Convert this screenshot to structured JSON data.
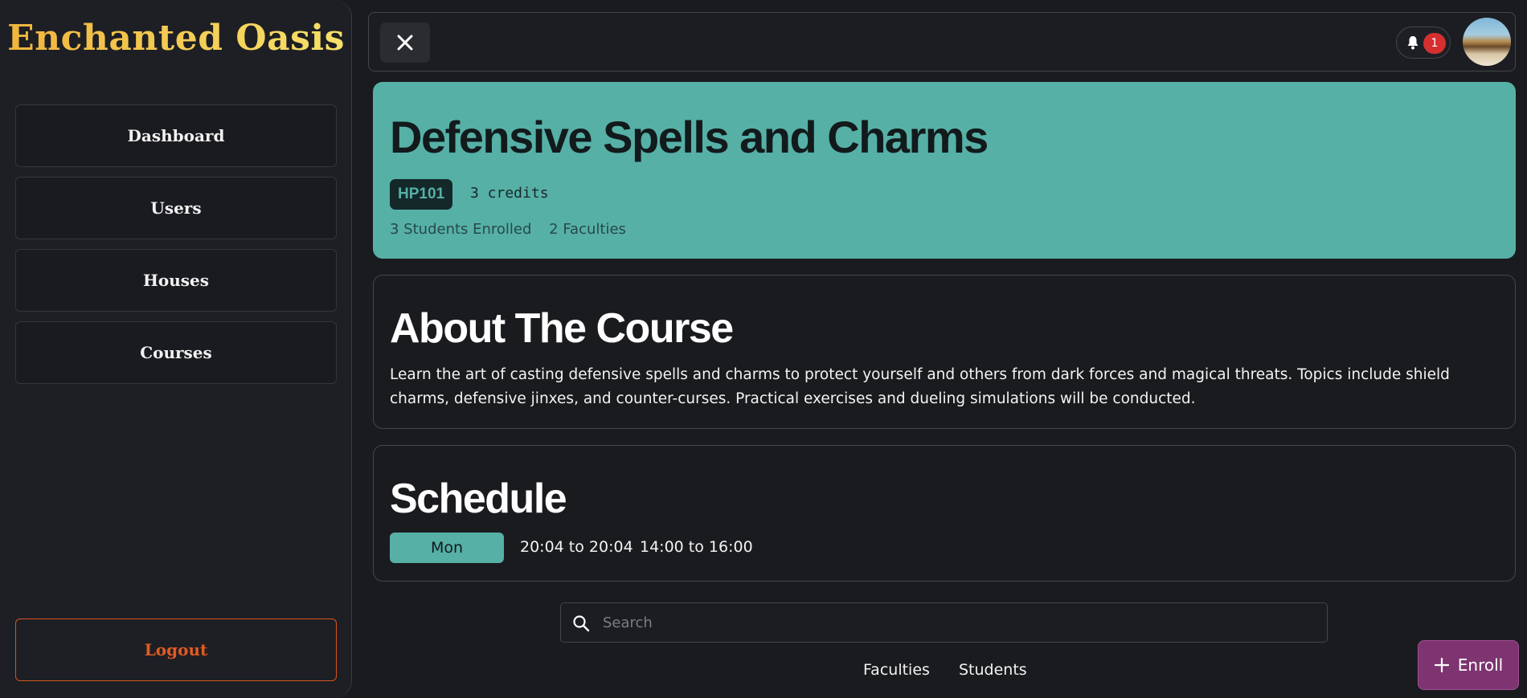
{
  "sidebar": {
    "brand": "Enchanted Oasis",
    "items": [
      {
        "label": "Dashboard"
      },
      {
        "label": "Users"
      },
      {
        "label": "Houses"
      },
      {
        "label": "Courses"
      }
    ],
    "logout_label": "Logout"
  },
  "topbar": {
    "close_icon": "close-icon",
    "notification_icon": "bell-icon",
    "notification_count": "1"
  },
  "course": {
    "title": "Defensive Spells and Charms",
    "code": "HP101",
    "credits": "3 credits",
    "students_enrolled": "3 Students Enrolled",
    "faculties": "2 Faculties"
  },
  "about": {
    "title": "About The Course",
    "description": "Learn the art of casting defensive spells and charms to protect yourself and others from dark forces and magical threats. Topics include shield charms, defensive jinxes, and counter-curses. Practical exercises and dueling simulations will be conducted."
  },
  "schedule": {
    "title": "Schedule",
    "day": "Mon",
    "slots": [
      "20:04 to 20:04",
      "14:00 to 16:00"
    ]
  },
  "search": {
    "placeholder": "Search",
    "value": ""
  },
  "tabs": [
    {
      "label": "Faculties"
    },
    {
      "label": "Students"
    }
  ],
  "enroll": {
    "label": "Enroll"
  },
  "colors": {
    "accent_teal": "#56b0a6",
    "enroll_purple": "#7e3470",
    "logout_orange": "#e25a22",
    "badge_red": "#d62f2f",
    "brand_gold": "#f4c542"
  }
}
